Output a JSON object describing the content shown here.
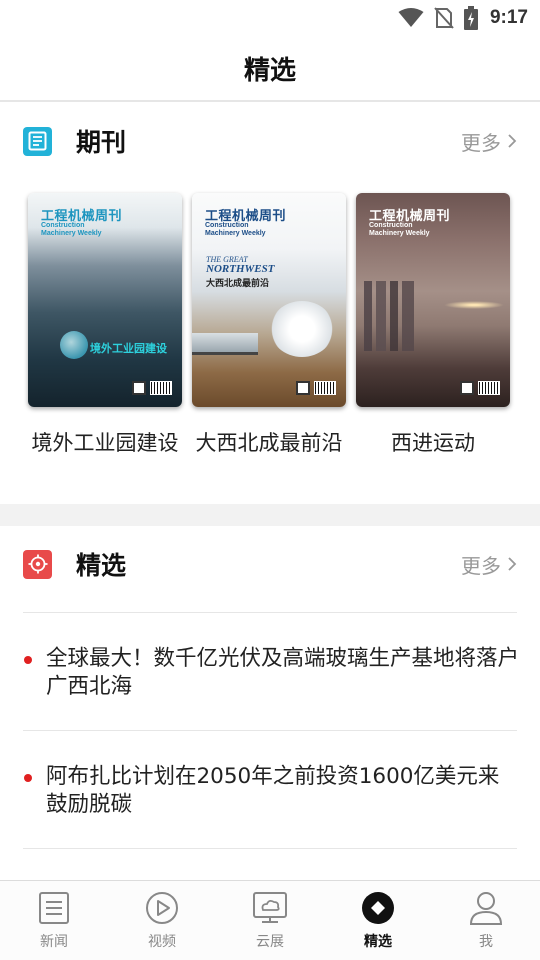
{
  "status_bar": {
    "time": "9:17"
  },
  "header": {
    "title": "精选"
  },
  "journals_section": {
    "title": "期刊",
    "more_label": "更多",
    "accent_color": "#22b2d8",
    "items": [
      {
        "label": "境外工业园建设",
        "cover": {
          "masthead": "工程机械周刊",
          "masthead_en_1": "Construction",
          "masthead_en_2": "Machinery Weekly",
          "cover_text": "境外工业园建设"
        }
      },
      {
        "label": "大西北成最前沿",
        "cover": {
          "masthead": "工程机械周刊",
          "masthead_en_1": "Construction",
          "masthead_en_2": "Machinery Weekly",
          "tagline_1": "THE GREAT",
          "tagline_2": "NORTHWEST",
          "cover_text": "大西北成最前沿"
        }
      },
      {
        "label": "西进运动",
        "cover": {
          "masthead": "工程机械周刊",
          "masthead_en_1": "Construction",
          "masthead_en_2": "Machinery Weekly"
        }
      }
    ]
  },
  "featured_section": {
    "title": "精选",
    "more_label": "更多",
    "accent_color": "#e84a4a",
    "items": [
      {
        "headline": "全球最大！数千亿光伏及高端玻璃生产基地将落户广西北海"
      },
      {
        "headline": "阿布扎比计划在2050年之前投资1600亿美元来鼓励脱碳"
      }
    ]
  },
  "tab_bar": {
    "active_index": 3,
    "tabs": [
      {
        "label": "新闻",
        "icon": "news-icon"
      },
      {
        "label": "视频",
        "icon": "video-play-icon"
      },
      {
        "label": "云展",
        "icon": "cloud-expo-icon"
      },
      {
        "label": "精选",
        "icon": "featured-diamond-icon"
      },
      {
        "label": "我",
        "icon": "profile-icon"
      }
    ]
  }
}
